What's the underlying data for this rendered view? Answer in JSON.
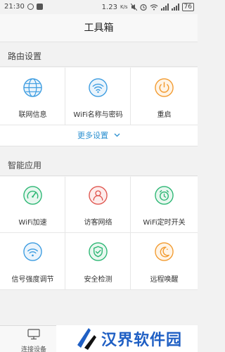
{
  "status_bar": {
    "time": "21:30",
    "speed": "1.23",
    "speed_unit": "K/s",
    "battery": "76"
  },
  "header": {
    "title": "工具箱"
  },
  "routing": {
    "section_title": "路由设置",
    "items": [
      {
        "label": "联网信息",
        "icon": "globe-icon"
      },
      {
        "label": "WiFi名称与密码",
        "icon": "wifi-icon"
      },
      {
        "label": "重启",
        "icon": "power-icon"
      }
    ],
    "more_label": "更多设置"
  },
  "apps": {
    "section_title": "智能应用",
    "items": [
      {
        "label": "WiFi加速",
        "icon": "speedometer-icon"
      },
      {
        "label": "访客网络",
        "icon": "guest-user-icon"
      },
      {
        "label": "WiFi定时开关",
        "icon": "alarm-clock-icon"
      },
      {
        "label": "信号强度调节",
        "icon": "signal-strength-icon"
      },
      {
        "label": "安全检测",
        "icon": "shield-check-icon"
      },
      {
        "label": "远程唤醒",
        "icon": "moon-icon"
      }
    ]
  },
  "bottom_nav": {
    "device_tab": "连接设备"
  },
  "watermark": {
    "text": "汉界软件园"
  },
  "colors": {
    "accent_blue": "#2a8fd0",
    "icon_green": "#2bb673",
    "icon_red": "#e0564f",
    "icon_orange": "#f29a2e",
    "icon_blue": "#3a9be0"
  }
}
